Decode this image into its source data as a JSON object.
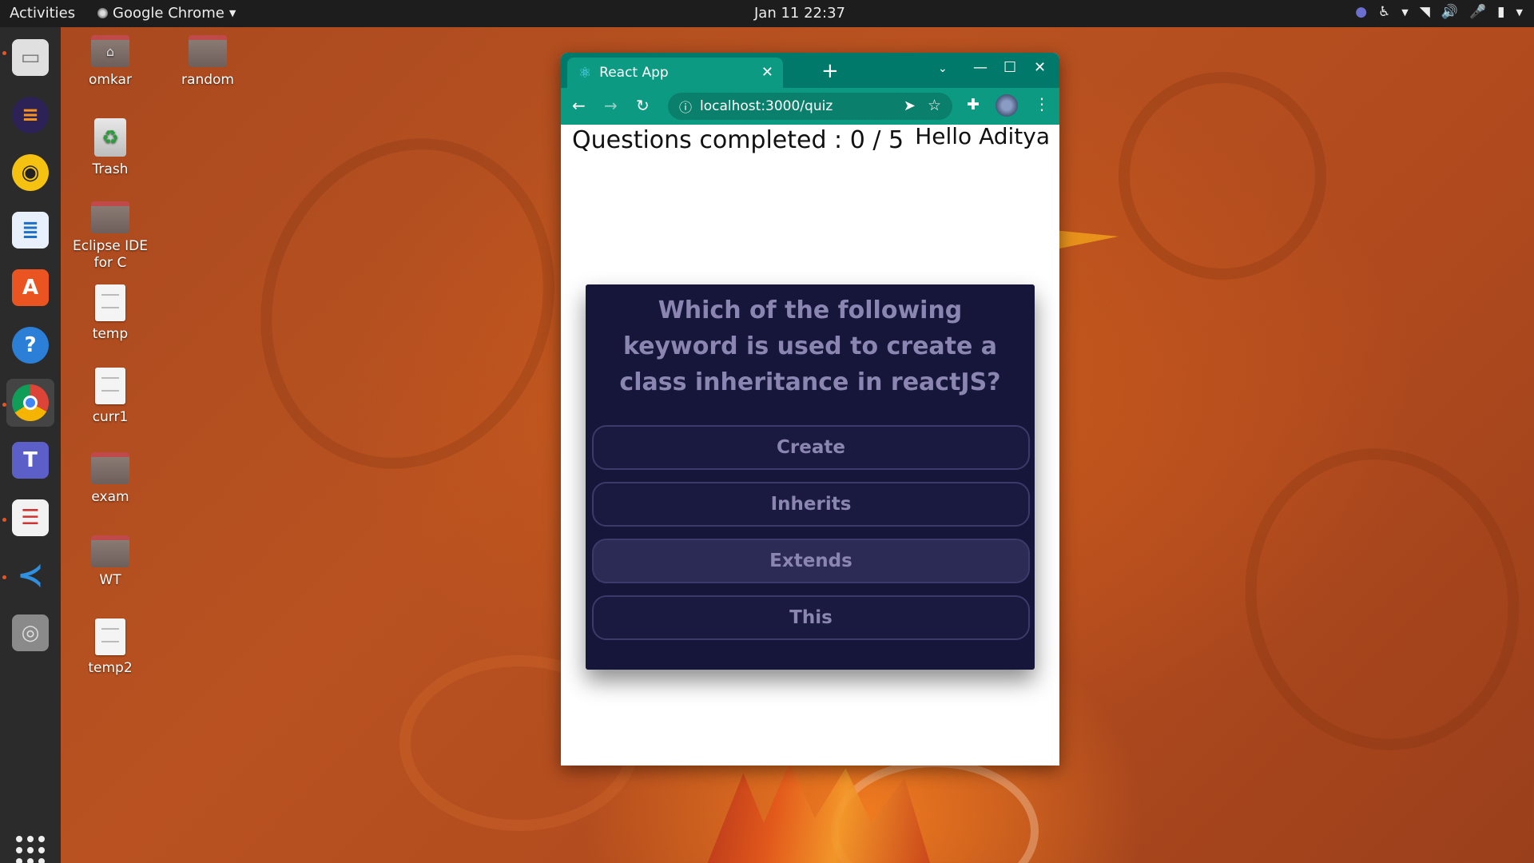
{
  "topbar": {
    "activities": "Activities",
    "app_name": "Google Chrome",
    "clock": "Jan 11  22:37"
  },
  "desktop_icons": [
    {
      "label": "omkar",
      "kind": "home-folder"
    },
    {
      "label": "random",
      "kind": "folder"
    },
    {
      "label": "Trash",
      "kind": "trash"
    },
    {
      "label": "Eclipse IDE for C",
      "kind": "folder"
    },
    {
      "label": "temp",
      "kind": "document"
    },
    {
      "label": "curr1",
      "kind": "document"
    },
    {
      "label": "exam",
      "kind": "folder"
    },
    {
      "label": "WT",
      "kind": "folder"
    },
    {
      "label": "temp2",
      "kind": "document"
    }
  ],
  "browser": {
    "tab_title": "React App",
    "url": "localhost:3000/quiz",
    "accent": "#00796b"
  },
  "quiz": {
    "progress": "Questions completed : 0 / 5",
    "greeting": "Hello Aditya",
    "question": "Which of the following keyword is used to create a class inheritance in reactJS?",
    "options": [
      "Create",
      "Inherits",
      "Extends",
      "This"
    ]
  }
}
